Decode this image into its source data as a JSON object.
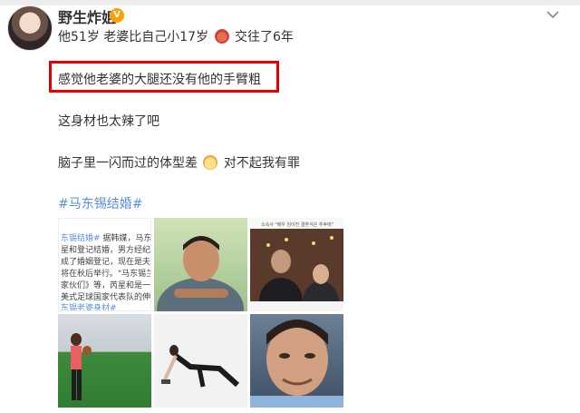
{
  "post": {
    "author_name": "野生炸姐",
    "lines": [
      {
        "before": "他51岁 老婆比自己小17岁",
        "emoji": "shy-face",
        "after": "交往了6年"
      },
      {
        "text": "感觉他老婆的大腿还没有他的手臂粗"
      },
      {
        "text": "这身材也太辣了吧"
      },
      {
        "before": "脑子里一闪而过的体型差",
        "emoji": "cat-face",
        "after": "对不起我有罪"
      }
    ],
    "hashtag": "#马东锡结婚#"
  },
  "images": {
    "article_text_lines": [
      {
        "tag": "东锡结婚#",
        "text": " 据韩媒，马东锡"
      },
      {
        "text": "星和登记结婚，男方经纪"
      },
      {
        "text": "成了婚姻登记，现在是夫"
      },
      {
        "text": "将在秋后举行。\"马东锡兰"
      },
      {
        "text": "家伙们》等，芮星和是一"
      },
      {
        "text": "美式足球国家代表队的伸"
      },
      {
        "tag": "东锡老婆身材#",
        "text": ""
      }
    ],
    "news_caption": "소속사 \"배우 임이진 결혼식은 추후에\""
  },
  "colors": {
    "highlight": "#e00000",
    "hashtag": "#5b8fd9",
    "verified_badge": "#f7a400"
  }
}
